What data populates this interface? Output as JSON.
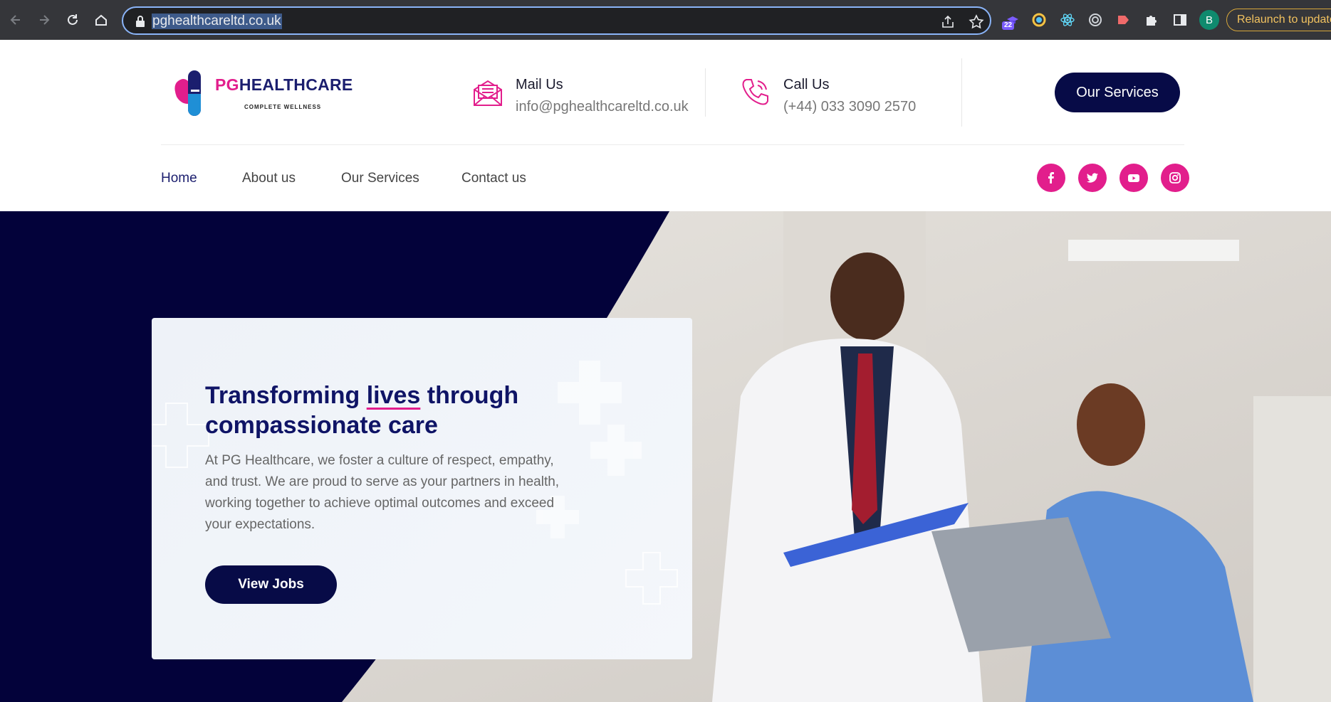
{
  "browser": {
    "url": "pghealthcareltd.co.uk",
    "extension_badge": "22",
    "profile_initial": "B",
    "relaunch_label": "Relaunch to update"
  },
  "site": {
    "logo": {
      "brand_prefix": "PG",
      "brand_rest": "HEALTHCARE",
      "tagline": "COMPLETE WELLNESS"
    },
    "mail": {
      "title": "Mail Us",
      "value": "info@pghealthcareltd.co.uk"
    },
    "call": {
      "title": "Call Us",
      "value": "(+44) 033 3090 2570"
    },
    "services_button": "Our Services",
    "menu": [
      {
        "label": "Home",
        "active": true
      },
      {
        "label": "About us"
      },
      {
        "label": "Our Services"
      },
      {
        "label": "Contact us"
      }
    ],
    "social": [
      "facebook-icon",
      "twitter-icon",
      "youtube-icon",
      "instagram-icon"
    ],
    "brand_colors": {
      "navy": "#070b47",
      "pink": "#e21e8c"
    }
  },
  "hero": {
    "title_before": "Transforming ",
    "title_highlight": "lives",
    "title_after": " through compassionate care",
    "description": "At PG Healthcare, we foster a culture of respect, empathy, and trust. We are proud to serve as your partners in health, working together to achieve optimal outcomes and exceed your expectations.",
    "cta": "View Jobs"
  }
}
